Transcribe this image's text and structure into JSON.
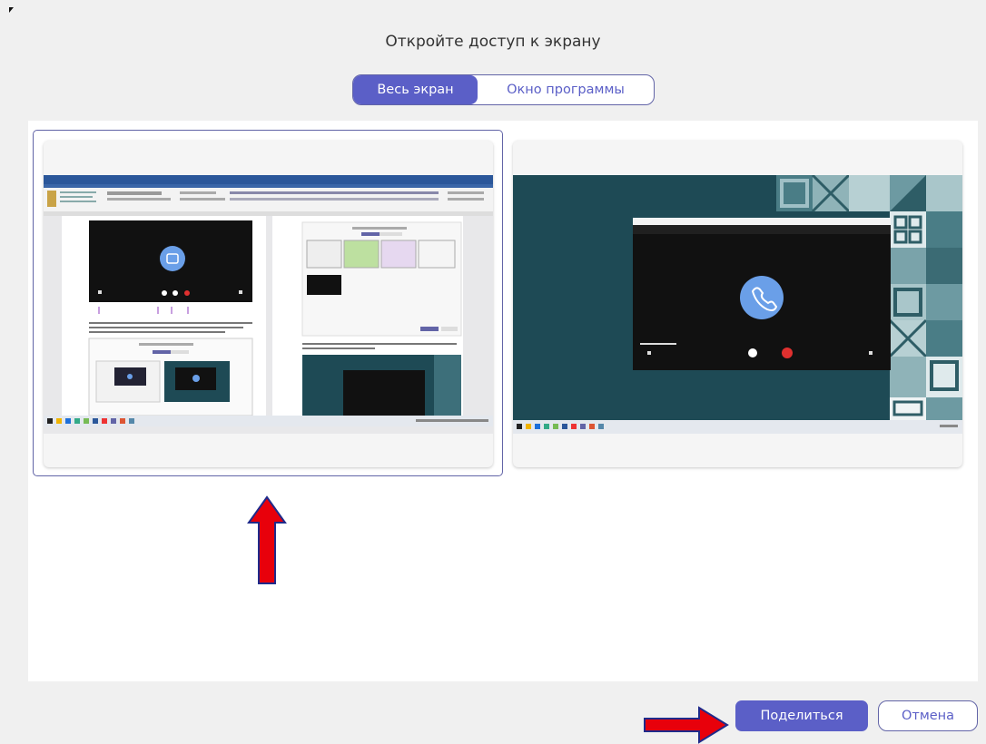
{
  "dialog": {
    "title": "Откройте доступ к экрану"
  },
  "tabs": [
    {
      "label": "Весь экран",
      "active": true
    },
    {
      "label": "Окно программы",
      "active": false
    }
  ],
  "screens": [
    {
      "name": "screen-1",
      "selected": true
    },
    {
      "name": "screen-2",
      "selected": false
    }
  ],
  "actions": {
    "share_label": "Поделиться",
    "cancel_label": "Отмена"
  },
  "colors": {
    "accent": "#5b5fc7",
    "annotation_arrow": "#e8000b",
    "desktop_teal": "#1e4a55"
  },
  "annotations": [
    "up-arrow-under-screen-1",
    "right-arrow-to-share-button"
  ]
}
